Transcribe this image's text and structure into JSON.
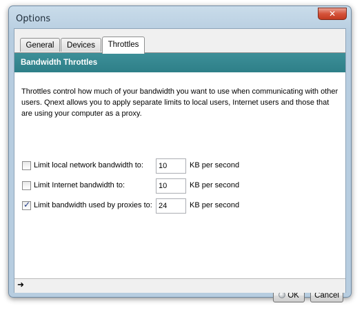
{
  "window": {
    "title": "Options",
    "close_glyph": "✕"
  },
  "tabs": [
    {
      "label": "General",
      "active": false
    },
    {
      "label": "Devices",
      "active": false
    },
    {
      "label": "Throttles",
      "active": true
    }
  ],
  "section": {
    "header": "Bandwidth Throttles",
    "description": "Throttles control how much of your bandwidth you want to use when communicating with other users. Qnext allows you to apply separate limits to local users, Internet users and those that are using your computer as a proxy."
  },
  "throttles": [
    {
      "label": "Limit local network bandwidth to:",
      "checked": false,
      "value": "10",
      "unit": "KB per second"
    },
    {
      "label": "Limit Internet bandwidth to:",
      "checked": false,
      "value": "10",
      "unit": "KB per second"
    },
    {
      "label": "Limit bandwidth used by proxies to:",
      "checked": true,
      "value": "24",
      "unit": "KB per second"
    }
  ],
  "buttons": {
    "ok": "OK",
    "cancel": "Cancel"
  },
  "status": {
    "arrow_icon": "right-arrow-icon",
    "arrow_glyph": "➜"
  }
}
